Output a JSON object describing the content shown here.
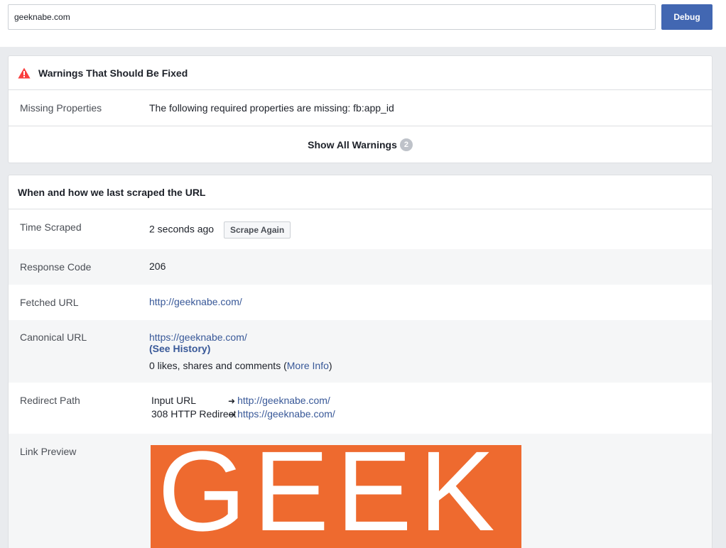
{
  "search": {
    "value": "geeknabe.com",
    "debug_label": "Debug"
  },
  "warnings": {
    "title": "Warnings That Should Be Fixed",
    "missing_label": "Missing Properties",
    "missing_text": "The following required properties are missing: fb:app_id",
    "show_all_label": "Show All Warnings",
    "count": "2"
  },
  "scrape": {
    "title": "When and how we last scraped the URL",
    "time_label": "Time Scraped",
    "time_value": "2 seconds ago",
    "scrape_again_label": "Scrape Again",
    "response_label": "Response Code",
    "response_value": "206",
    "fetched_label": "Fetched URL",
    "fetched_value": "http://geeknabe.com/",
    "canonical_label": "Canonical URL",
    "canonical_value": "https://geeknabe.com/",
    "see_history": "(See History)",
    "likes_text": "0 likes, shares and comments (",
    "more_info": "More Info",
    "likes_close": ")",
    "redirect_label": "Redirect Path",
    "redirects": [
      {
        "label": "Input URL",
        "url": "http://geeknabe.com/"
      },
      {
        "label": "308 HTTP Redirect",
        "url": "https://geeknabe.com/"
      }
    ],
    "preview_label": "Link Preview",
    "preview_logo_text": "GEEK"
  },
  "colors": {
    "accent": "#4267b2",
    "link": "#385898",
    "warning": "#fa3e3e",
    "preview_bg": "#ee6a2f"
  }
}
